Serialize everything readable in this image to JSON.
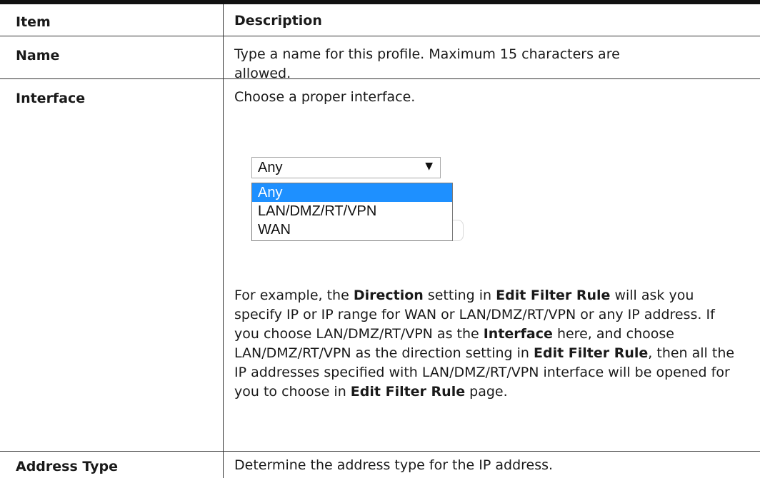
{
  "table": {
    "headers": {
      "item": "Item",
      "description": "Description"
    },
    "rows": [
      {
        "item": "Name",
        "description": "Type a name for this profile. Maximum 15 characters are allowed."
      },
      {
        "item": "Interface",
        "description_intro": "Choose a proper interface."
      },
      {
        "item": "Address Type",
        "description": "Determine the address type for the IP address."
      }
    ]
  },
  "interface_dropdown": {
    "selected_value": "Any",
    "options": [
      "Any",
      "LAN/DMZ/RT/VPN",
      "WAN"
    ],
    "highlighted_option": "Any",
    "highlight_color": "#1e90ff"
  },
  "interface_paragraph": {
    "p1": "For example, the ",
    "k1": "Direction",
    "p2": " setting in ",
    "k2": "Edit Filter Rule",
    "p3": " will ask you specify IP or IP range for WAN or LAN/DMZ/RT/VPN or any IP address. If you choose LAN/DMZ/RT/VPN as the ",
    "k3": "Interface",
    "p4": " here, and choose LAN/DMZ/RT/VPN as the direction setting in ",
    "k4": "Edit Filter Rule",
    "p5": ", then all the IP addresses specified with LAN/DMZ/RT/VPN interface will be opened for you to choose in ",
    "k5": "Edit Filter Rule",
    "p6": " page."
  }
}
